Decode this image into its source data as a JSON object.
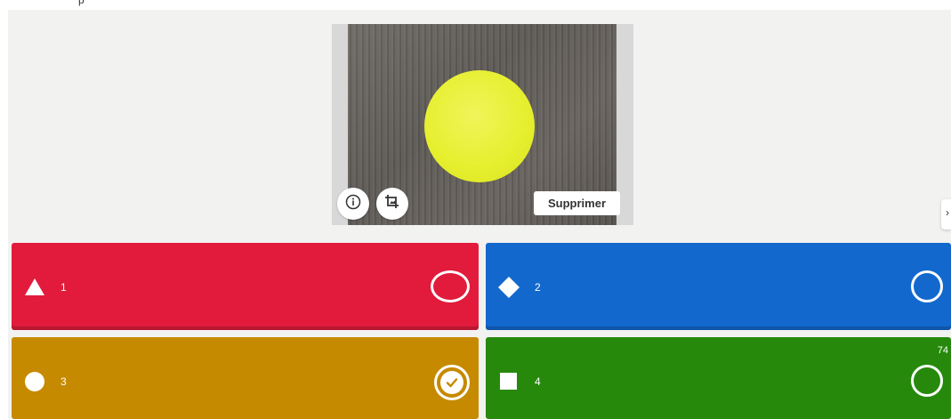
{
  "header": {
    "partial_text": "p"
  },
  "media": {
    "delete_label": "Supprimer",
    "info_icon": "info-icon",
    "crop_icon": "crop-icon"
  },
  "answers": [
    {
      "shape": "triangle-icon",
      "label": "1",
      "color": "#e21b3c",
      "selected": false
    },
    {
      "shape": "diamond-icon",
      "label": "2",
      "color": "#1368ce",
      "selected": false
    },
    {
      "shape": "circle-icon",
      "label": "3",
      "color": "#c68a00",
      "selected": true
    },
    {
      "shape": "square-icon",
      "label": "4",
      "color": "#26890c",
      "selected": false
    }
  ],
  "counter": "74",
  "side_handle": {
    "glyph": "›"
  }
}
